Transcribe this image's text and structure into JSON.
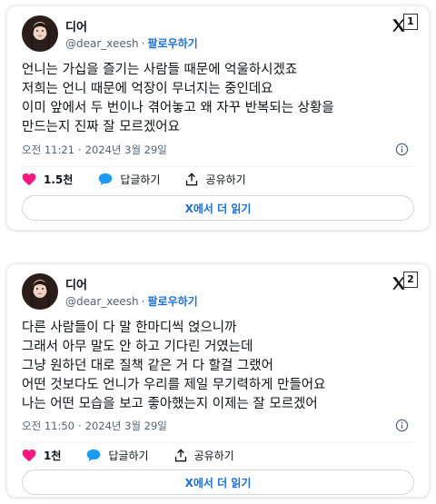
{
  "colors": {
    "accent": "#1d6fd8",
    "like": "#f91880",
    "reply": "#1d9bf0",
    "muted": "#536471"
  },
  "tweets": [
    {
      "user": {
        "name": "디어",
        "handle": "@dear_xeesh",
        "follow_label": "팔로우하기"
      },
      "badge": "1",
      "text": "언니는 가십을 즐기는 사람들 때문에 억울하시겠죠\n저희는 언니 때문에 억장이 무너지는 중인데요\n이미 앞에서 두 번이나 겪어놓고 왜 자꾸 반복되는 상황을\n만드는지 진짜 잘 모르겠어요",
      "time": "오전 11:21",
      "date": "2024년 3월 29일",
      "likes": "1.5천",
      "reply_label": "답글하기",
      "share_label": "공유하기",
      "read_more": "X에서 더 읽기",
      "icons": {
        "like": "heart-icon",
        "reply": "reply-bubble-icon",
        "share": "share-icon",
        "info": "info-icon",
        "logo": "x-logo-icon"
      }
    },
    {
      "user": {
        "name": "디어",
        "handle": "@dear_xeesh",
        "follow_label": "팔로우하기"
      },
      "badge": "2",
      "text": "다른 사람들이 다 말 한마디씩 얹으니까\n그래서 아무 말도 안 하고 기다린 거였는데\n그냥 원하던 대로 질책 같은 거 다 할걸 그랬어\n어떤 것보다도 언니가 우리를 제일 무기력하게 만들어요\n나는 어떤 모습을 보고 좋아했는지 이제는 잘 모르겠어",
      "time": "오전 11:50",
      "date": "2024년 3월 29일",
      "likes": "1천",
      "reply_label": "답글하기",
      "share_label": "공유하기",
      "read_more": "X에서 더 읽기",
      "icons": {
        "like": "heart-icon",
        "reply": "reply-bubble-icon",
        "share": "share-icon",
        "info": "info-icon",
        "logo": "x-logo-icon"
      }
    }
  ]
}
